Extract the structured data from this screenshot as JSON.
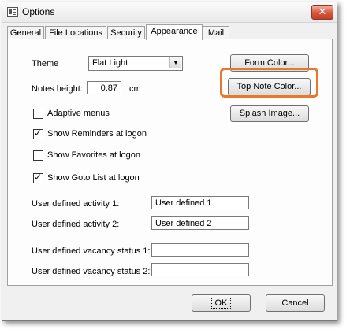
{
  "window": {
    "title": "Options",
    "close_glyph": "✕"
  },
  "tabs": [
    {
      "label": "General"
    },
    {
      "label": "File Locations"
    },
    {
      "label": "Security"
    },
    {
      "label": "Appearance",
      "active": true
    },
    {
      "label": "Mail"
    }
  ],
  "appearance": {
    "theme_label": "Theme",
    "theme_value": "Flat Light",
    "notes_height_label": "Notes height:",
    "notes_height_value": "0.87",
    "notes_height_unit": "cm",
    "form_color_button": "Form Color...",
    "top_note_color_button": "Top Note Color...",
    "splash_image_button": "Splash Image...",
    "checkboxes": [
      {
        "label": "Adaptive menus",
        "checked": false
      },
      {
        "label": "Show Reminders at logon",
        "checked": true
      },
      {
        "label": "Show Favorites at logon",
        "checked": false
      },
      {
        "label": "Show Goto List at logon",
        "checked": true
      }
    ],
    "activity1_label": "User defined activity 1:",
    "activity1_value": "User defined 1",
    "activity2_label": "User defined activity 2:",
    "activity2_value": "User defined 2",
    "vacancy1_label": "User defined vacancy status 1:",
    "vacancy1_value": "",
    "vacancy2_label": "User defined vacancy status 2:",
    "vacancy2_value": ""
  },
  "footer": {
    "ok_label": "OK",
    "cancel_label": "Cancel"
  },
  "colors": {
    "highlight": "#e8782c",
    "close_button": "#c44128"
  }
}
